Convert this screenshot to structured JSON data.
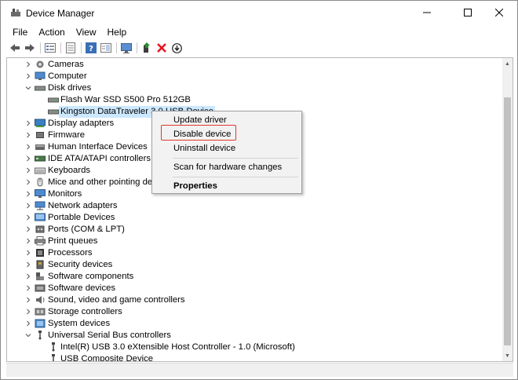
{
  "window": {
    "title": "Device Manager"
  },
  "menu": [
    "File",
    "Action",
    "View",
    "Help"
  ],
  "toolbar": [
    {
      "name": "back-icon"
    },
    {
      "name": "forward-icon"
    },
    {
      "sep": true
    },
    {
      "name": "properties-list-icon"
    },
    {
      "sep": true
    },
    {
      "name": "device-list-icon"
    },
    {
      "sep": true
    },
    {
      "name": "help-icon"
    },
    {
      "name": "view-panel-icon"
    },
    {
      "sep": true
    },
    {
      "name": "monitor-scan-icon"
    },
    {
      "sep": true
    },
    {
      "name": "update-driver-icon"
    },
    {
      "name": "uninstall-x-icon"
    },
    {
      "name": "download-disable-icon"
    }
  ],
  "tree": [
    {
      "label": "Cameras",
      "level": 1,
      "expanded": false,
      "icon": "camera-icon"
    },
    {
      "label": "Computer",
      "level": 1,
      "expanded": false,
      "icon": "computer-icon"
    },
    {
      "label": "Disk drives",
      "level": 1,
      "expanded": true,
      "icon": "disk-drive-icon"
    },
    {
      "label": "Flash War SSD S500 Pro 512GB",
      "level": 2,
      "icon": "disk-drive-icon"
    },
    {
      "label": "Kingston DataTraveler 3.0 USB Device",
      "level": 2,
      "icon": "disk-drive-icon",
      "selected": true
    },
    {
      "label": "Display adapters",
      "level": 1,
      "expanded": false,
      "icon": "display-adapter-icon"
    },
    {
      "label": "Firmware",
      "level": 1,
      "expanded": false,
      "icon": "firmware-icon"
    },
    {
      "label": "Human Interface Devices",
      "level": 1,
      "expanded": false,
      "icon": "hid-icon"
    },
    {
      "label": "IDE ATA/ATAPI controllers",
      "level": 1,
      "expanded": false,
      "icon": "ide-controller-icon"
    },
    {
      "label": "Keyboards",
      "level": 1,
      "expanded": false,
      "icon": "keyboard-icon"
    },
    {
      "label": "Mice and other pointing devices",
      "level": 1,
      "expanded": false,
      "icon": "mouse-icon"
    },
    {
      "label": "Monitors",
      "level": 1,
      "expanded": false,
      "icon": "monitor-icon"
    },
    {
      "label": "Network adapters",
      "level": 1,
      "expanded": false,
      "icon": "network-adapter-icon"
    },
    {
      "label": "Portable Devices",
      "level": 1,
      "expanded": false,
      "icon": "portable-device-icon"
    },
    {
      "label": "Ports (COM & LPT)",
      "level": 1,
      "expanded": false,
      "icon": "port-icon"
    },
    {
      "label": "Print queues",
      "level": 1,
      "expanded": false,
      "icon": "printer-icon"
    },
    {
      "label": "Processors",
      "level": 1,
      "expanded": false,
      "icon": "processor-icon"
    },
    {
      "label": "Security devices",
      "level": 1,
      "expanded": false,
      "icon": "security-device-icon"
    },
    {
      "label": "Software components",
      "level": 1,
      "expanded": false,
      "icon": "software-component-icon"
    },
    {
      "label": "Software devices",
      "level": 1,
      "expanded": false,
      "icon": "software-device-icon"
    },
    {
      "label": "Sound, video and game controllers",
      "level": 1,
      "expanded": false,
      "icon": "sound-icon"
    },
    {
      "label": "Storage controllers",
      "level": 1,
      "expanded": false,
      "icon": "storage-controller-icon"
    },
    {
      "label": "System devices",
      "level": 1,
      "expanded": false,
      "icon": "system-device-icon"
    },
    {
      "label": "Universal Serial Bus controllers",
      "level": 1,
      "expanded": true,
      "icon": "usb-icon"
    },
    {
      "label": "Intel(R) USB 3.0 eXtensible Host Controller - 1.0 (Microsoft)",
      "level": 2,
      "icon": "usb-icon"
    },
    {
      "label": "USB Composite Device",
      "level": 2,
      "icon": "usb-icon"
    }
  ],
  "context_menu": {
    "items": [
      {
        "label": "Update driver",
        "name": "ctx-update-driver"
      },
      {
        "label": "Disable device",
        "name": "ctx-disable-device",
        "highlighted": true
      },
      {
        "label": "Uninstall device",
        "name": "ctx-uninstall-device"
      },
      {
        "sep": true
      },
      {
        "label": "Scan for hardware changes",
        "name": "ctx-scan-hardware"
      },
      {
        "sep": true
      },
      {
        "label": "Properties",
        "name": "ctx-properties",
        "bold": true
      }
    ]
  },
  "colors": {
    "selection": "#cce8ff",
    "highlight_box": "#e2382a",
    "uninstall_red": "#e81123",
    "update_green": "#2e8b2e"
  }
}
